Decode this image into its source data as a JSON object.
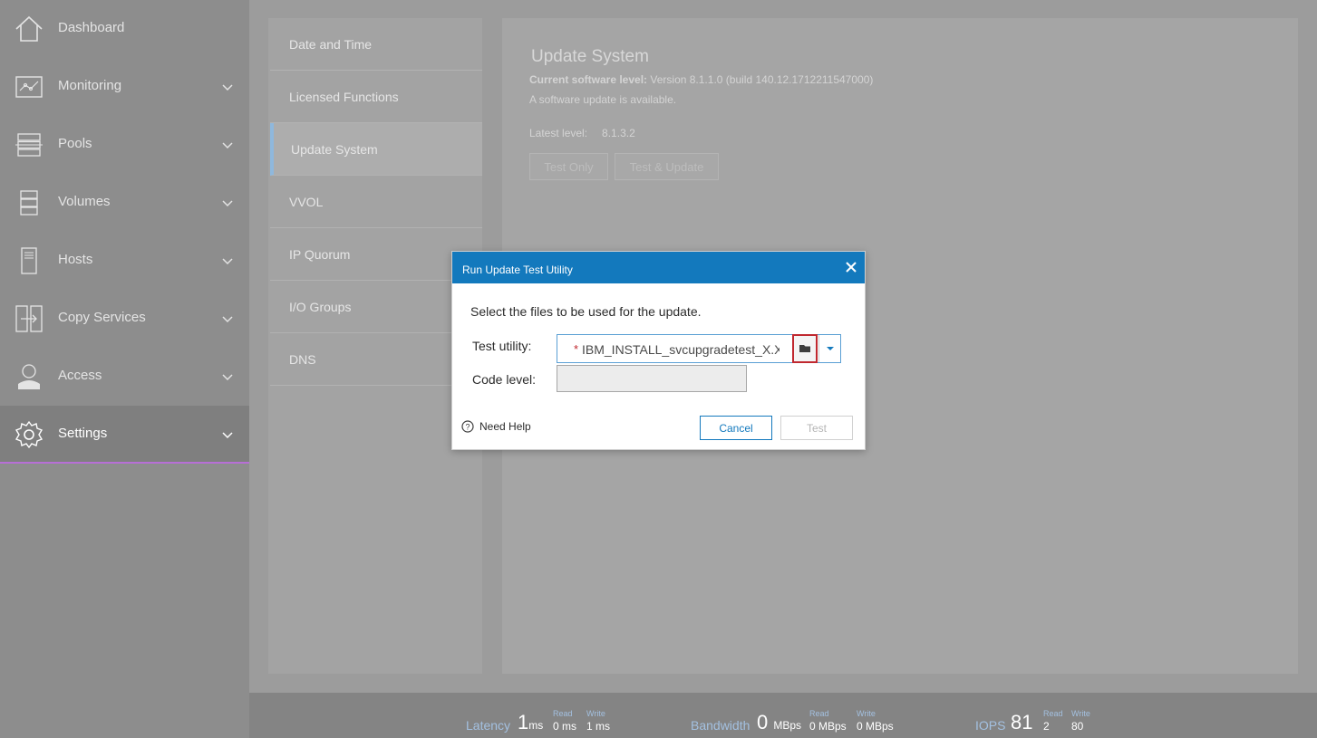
{
  "sidebar": {
    "items": [
      {
        "label": "Dashboard",
        "icon": "home-icon"
      },
      {
        "label": "Monitoring",
        "icon": "monitoring-icon"
      },
      {
        "label": "Pools",
        "icon": "pools-icon"
      },
      {
        "label": "Volumes",
        "icon": "volumes-icon"
      },
      {
        "label": "Hosts",
        "icon": "hosts-icon"
      },
      {
        "label": "Copy Services",
        "icon": "copy-services-icon"
      },
      {
        "label": "Access",
        "icon": "user-icon"
      },
      {
        "label": "Settings",
        "icon": "gear-icon",
        "active": true
      }
    ]
  },
  "subnav": {
    "items": [
      {
        "label": "Date and Time"
      },
      {
        "label": "Licensed Functions"
      },
      {
        "label": "Update System",
        "active": true
      },
      {
        "label": "VVOL"
      },
      {
        "label": "IP Quorum"
      },
      {
        "label": "I/O Groups"
      },
      {
        "label": "DNS"
      }
    ]
  },
  "content": {
    "title": "Update System",
    "software_level_label": "Current software level:",
    "software_level_value": "Version 8.1.1.0 (build 140.12.1712211547000)",
    "update_notice": "A software update is available.",
    "latest_label": "Latest level:",
    "latest_value": "8.1.3.2",
    "test_only_label": "Test Only",
    "test_update_label": "Test & Update"
  },
  "dialog": {
    "title": "Run Update Test Utility",
    "intro": "Select the files to be used for the update.",
    "test_utility_label": "Test utility:",
    "required_mark": "*",
    "test_utility_value": "IBM_INSTALL_svcupgradetest_X.X",
    "code_level_label": "Code level:",
    "help_label": "Need Help",
    "cancel_label": "Cancel",
    "test_label": "Test"
  },
  "statusbar": {
    "latency": {
      "label": "Latency",
      "value": "1",
      "unit": "ms",
      "read_label": "Read",
      "read_value": "0 ms",
      "write_label": "Write",
      "write_value": "1 ms"
    },
    "bandwidth": {
      "label": "Bandwidth",
      "value": "0",
      "unit": "MBps",
      "read_label": "Read",
      "read_value": "0 MBps",
      "write_label": "Write",
      "write_value": "0 MBps"
    },
    "iops": {
      "label": "IOPS",
      "value": "81",
      "read_label": "Read",
      "read_value": "2",
      "write_label": "Write",
      "write_value": "80"
    }
  },
  "colors": {
    "dialog_header": "#1379bd",
    "active_accent": "#b76fd6",
    "highlight_border": "#c0282f"
  }
}
